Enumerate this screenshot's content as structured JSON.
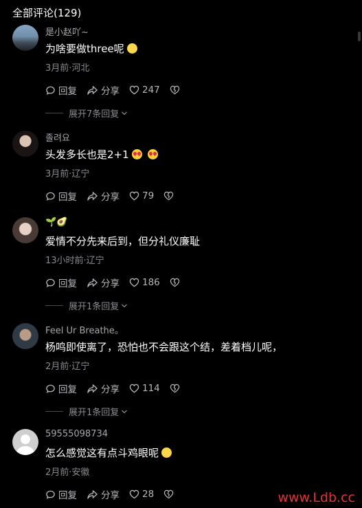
{
  "header": {
    "title": "全部评论(129)"
  },
  "actions": {
    "reply_label": "回复",
    "share_label": "分享"
  },
  "comments": [
    {
      "username": "是小赵吖~",
      "text": "为啥要做three呢",
      "emoji": "cry-icon",
      "meta": "3月前·河北",
      "likes": "247",
      "expand": "展开7条回复"
    },
    {
      "username": "졸려요",
      "text": "头发多长也是2+1",
      "emoji": "heart-eyes-icon",
      "meta": "3月前·辽宁",
      "likes": "79",
      "expand": ""
    },
    {
      "username": "🌱🥑",
      "text": "爱情不分先来后到，但分礼仪廉耻",
      "emoji": "",
      "meta": "13小时前·辽宁",
      "likes": "186",
      "expand": "展开1条回复"
    },
    {
      "username": "Feel Ur Breathe。",
      "text": "杨鸣即使离了，恐怕也不会跟这个结，差着档儿呢，",
      "emoji": "",
      "meta": "2月前·辽宁",
      "likes": "114",
      "expand": "展开1条回复"
    },
    {
      "username": "59555098734",
      "text": "怎么感觉这有点斗鸡眼呢",
      "emoji": "laughing-icon",
      "meta": "2月前·安徽",
      "likes": "28",
      "expand": ""
    }
  ],
  "watermark": "www.Ldb.cc",
  "colors": {
    "background": "#000000",
    "text": "#ffffff",
    "muted": "#8a8a90",
    "watermark": "#e0343a"
  }
}
